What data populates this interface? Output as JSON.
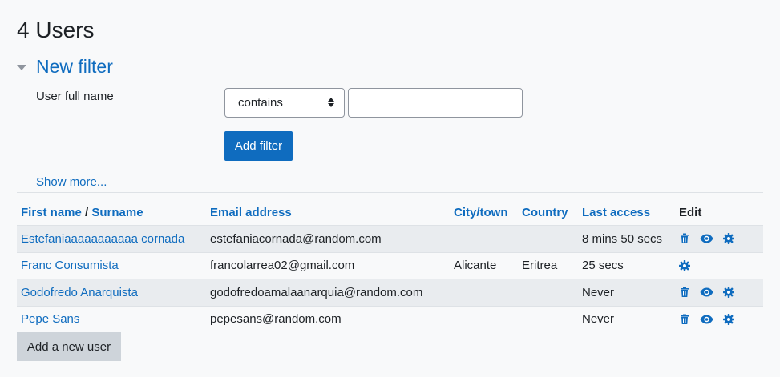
{
  "page": {
    "heading": "4 Users"
  },
  "filter": {
    "legend": "New filter",
    "field_label": "User full name",
    "operator_selected": "contains",
    "value": "",
    "add_button": "Add filter",
    "show_more": "Show more..."
  },
  "table": {
    "headers": {
      "first_name": "First name",
      "slash": " / ",
      "surname": "Surname",
      "email": "Email address",
      "city": "City/town",
      "country": "Country",
      "last_access": "Last access",
      "edit": "Edit"
    },
    "rows": [
      {
        "name": "Estefaniaaaaaaaaaaa cornada",
        "email": "estefaniacornada@random.com",
        "city": "",
        "country": "",
        "last_access": "8 mins 50 secs",
        "actions": [
          "trash-icon",
          "eye-icon",
          "gear-icon"
        ]
      },
      {
        "name": "Franc Consumista",
        "email": "francolarrea02@gmail.com",
        "city": "Alicante",
        "country": "Eritrea",
        "last_access": "25 secs",
        "actions": [
          "gear-icon"
        ]
      },
      {
        "name": "Godofredo Anarquista",
        "email": "godofredoamalaanarquia@random.com",
        "city": "",
        "country": "",
        "last_access": "Never",
        "actions": [
          "trash-icon",
          "eye-icon",
          "gear-icon"
        ]
      },
      {
        "name": "Pepe Sans",
        "email": "pepesans@random.com",
        "city": "",
        "country": "",
        "last_access": "Never",
        "actions": [
          "trash-icon",
          "eye-icon",
          "gear-icon"
        ]
      }
    ]
  },
  "footer": {
    "add_user_button": "Add a new user"
  },
  "colors": {
    "link": "#0f6cbf",
    "primary_button": "#0f6cbf",
    "secondary_button": "#ced4da",
    "row_shade": "#e9ecef",
    "background": "#f8f9fa"
  }
}
